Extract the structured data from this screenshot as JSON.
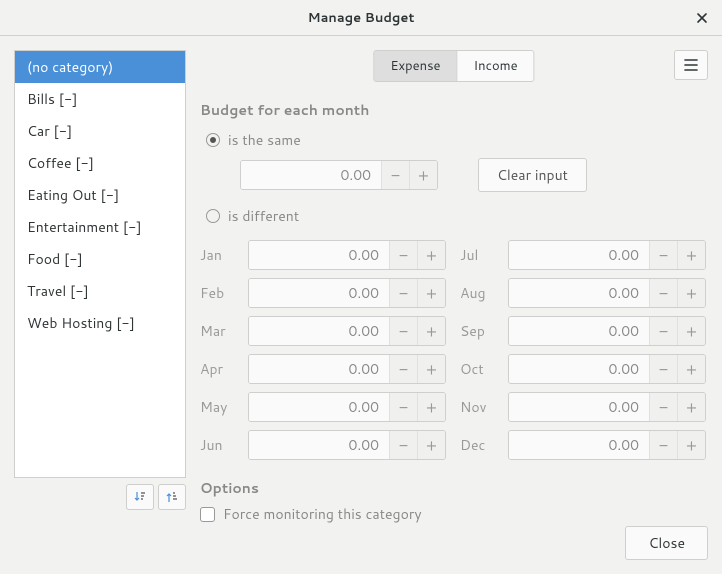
{
  "window": {
    "title": "Manage Budget"
  },
  "categories": [
    "(no category)",
    "Bills [-]",
    "Car [-]",
    "Coffee [-]",
    "Eating Out [-]",
    "Entertainment [-]",
    "Food [-]",
    "Travel [-]",
    "Web Hosting [-]"
  ],
  "selected_category_index": 0,
  "tabs": {
    "expense": "Expense",
    "income": "Income",
    "active": "expense"
  },
  "budget": {
    "heading": "Budget for each month",
    "same_label": "is the same",
    "different_label": "is different",
    "mode": "same",
    "same_value": "0.00",
    "clear_label": "Clear input"
  },
  "months": {
    "Jan": "0.00",
    "Feb": "0.00",
    "Mar": "0.00",
    "Apr": "0.00",
    "May": "0.00",
    "Jun": "0.00",
    "Jul": "0.00",
    "Aug": "0.00",
    "Sep": "0.00",
    "Oct": "0.00",
    "Nov": "0.00",
    "Dec": "0.00"
  },
  "options": {
    "heading": "Options",
    "force_monitor_label": "Force monitoring this category",
    "force_monitor_checked": false
  },
  "footer": {
    "close": "Close"
  }
}
